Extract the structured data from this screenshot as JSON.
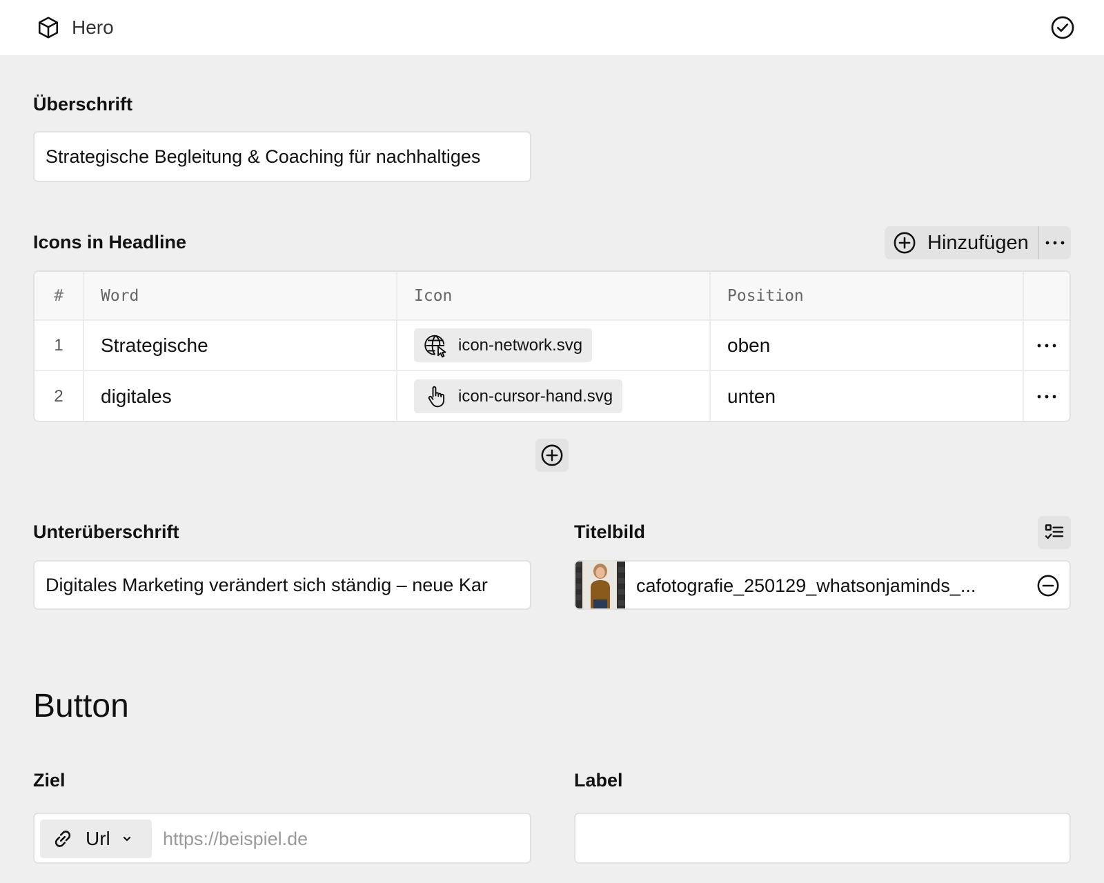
{
  "header": {
    "title": "Hero",
    "logo_icon": "cube-icon",
    "status_icon": "check-circle-icon"
  },
  "headline": {
    "label": "Überschrift",
    "value": "Strategische Begleitung & Coaching für nachhaltiges"
  },
  "icons_section": {
    "label": "Icons in Headline",
    "add_button_label": "Hinzufügen",
    "columns": {
      "num": "#",
      "word": "Word",
      "icon": "Icon",
      "position": "Position"
    },
    "rows": [
      {
        "num": "1",
        "word": "Strategische",
        "icon_file": "icon-network.svg",
        "icon": "globe-cursor-icon",
        "position": "oben"
      },
      {
        "num": "2",
        "word": "digitales",
        "icon_file": "icon-cursor-hand.svg",
        "icon": "hand-pointer-icon",
        "position": "unten"
      }
    ]
  },
  "subheadline": {
    "label": "Unterüberschrift",
    "value": "Digitales Marketing verändert sich ständig – neue Kar"
  },
  "title_image": {
    "label": "Titelbild",
    "filename": "cafotografie_250129_whatsonjaminds_..."
  },
  "button_section": {
    "heading": "Button",
    "target": {
      "label": "Ziel",
      "type": "Url",
      "placeholder": "https://beispiel.de",
      "value": ""
    },
    "label_field": {
      "label": "Label",
      "value": ""
    }
  },
  "colors": {
    "background": "#efefef",
    "surface": "#ffffff",
    "border": "#e1e1e1",
    "button": "#e3e3e3"
  }
}
